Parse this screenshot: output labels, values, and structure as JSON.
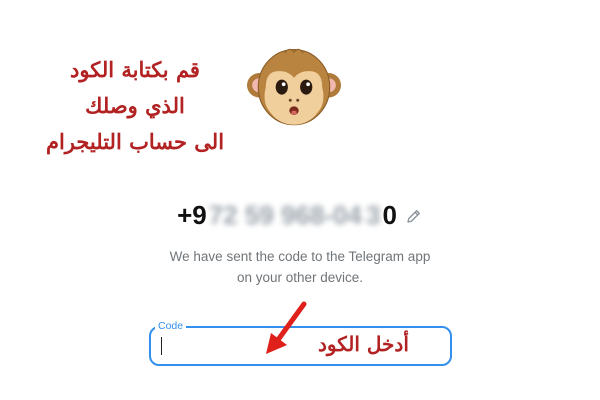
{
  "annotation": {
    "lines": [
      "قم بكتابة الكود",
      "الذي وصلك",
      "الى حساب التليجرام"
    ],
    "enter_code": "أدخل الكود",
    "color": "#b22222"
  },
  "monkey_icon": "monkey-emoji",
  "phone": {
    "prefix": "+9",
    "hidden_middle": "72 59 968-04",
    "blur_end": "3",
    "suffix": "0",
    "edit_icon": "pencil-icon"
  },
  "info": {
    "line1": "We have sent the code to the Telegram app",
    "line2": "on your other device."
  },
  "code_field": {
    "label": "Code",
    "value": "",
    "accent": "#3390ec"
  }
}
